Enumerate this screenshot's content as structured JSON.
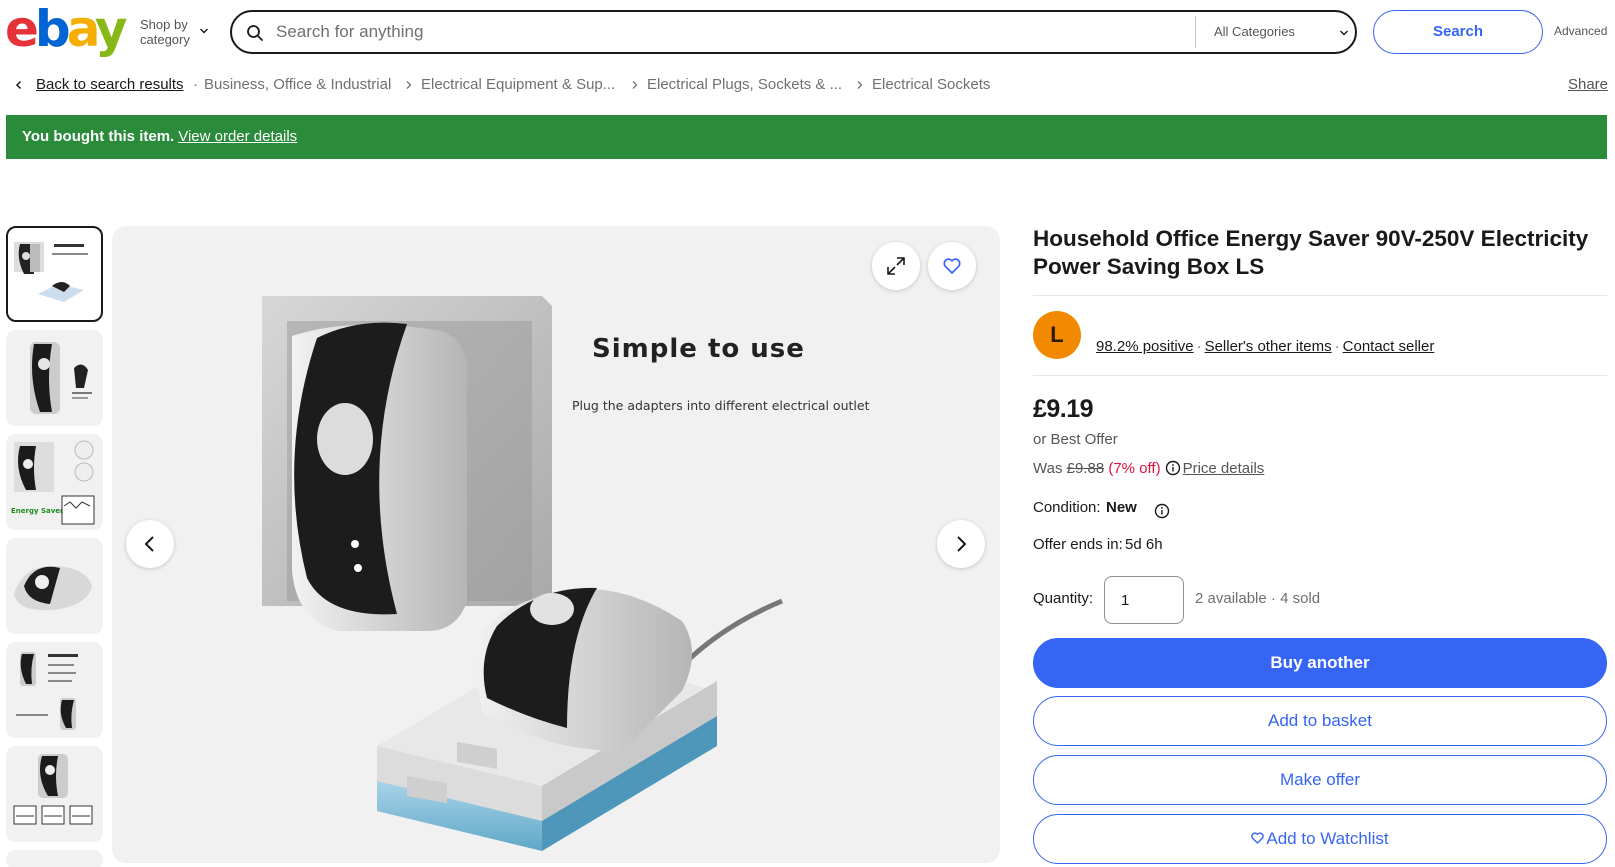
{
  "header": {
    "logo": {
      "e": "e",
      "b": "b",
      "a": "a",
      "y": "y"
    },
    "shop_by_line1": "Shop by",
    "shop_by_line2": "category",
    "search_placeholder": "Search for anything",
    "category_select": "All Categories",
    "search_button": "Search",
    "advanced": "Advanced"
  },
  "breadcrumb": {
    "back": "Back to search results",
    "items": [
      "Business, Office & Industrial",
      "Electrical Equipment & Sup...",
      "Electrical Plugs, Sockets & ...",
      "Electrical Sockets"
    ],
    "share": "Share"
  },
  "banner": {
    "message": "You bought this item.",
    "link": "View order details",
    "color": "#2a8b3a"
  },
  "gallery": {
    "thumbnail_count": 6,
    "selected_index": 0,
    "main_image_title": "Simple to use",
    "main_image_subtitle": "Plug the adapters into different electrical outlet",
    "thumb3_label": "Energy Saver"
  },
  "product": {
    "title": "Household Office Energy Saver 90V-250V Electricity Power Saving Box LS",
    "seller": {
      "avatar_letter": "L",
      "positive": "98.2% positive",
      "other_items": "Seller's other items",
      "contact": "Contact seller"
    },
    "price": "£9.19",
    "best_offer": "or Best Offer",
    "was_label": "Was",
    "was_price": "£9.88",
    "discount": "(7% off)",
    "price_details": "Price details",
    "condition_label": "Condition:",
    "condition_value": "New",
    "offer_ends_label": "Offer ends in:",
    "offer_ends_value": "5d 6h",
    "quantity_label": "Quantity:",
    "quantity_value": "1",
    "available": "2 available",
    "sold": "4 sold",
    "buttons": {
      "buy_another": "Buy another",
      "add_to_basket": "Add to basket",
      "make_offer": "Make offer",
      "add_to_watchlist": "Add to Watchlist"
    }
  },
  "colors": {
    "accent": "#3665f3",
    "banner": "#2a8b3a",
    "avatar": "#f18a00",
    "discount": "#e0103a"
  }
}
